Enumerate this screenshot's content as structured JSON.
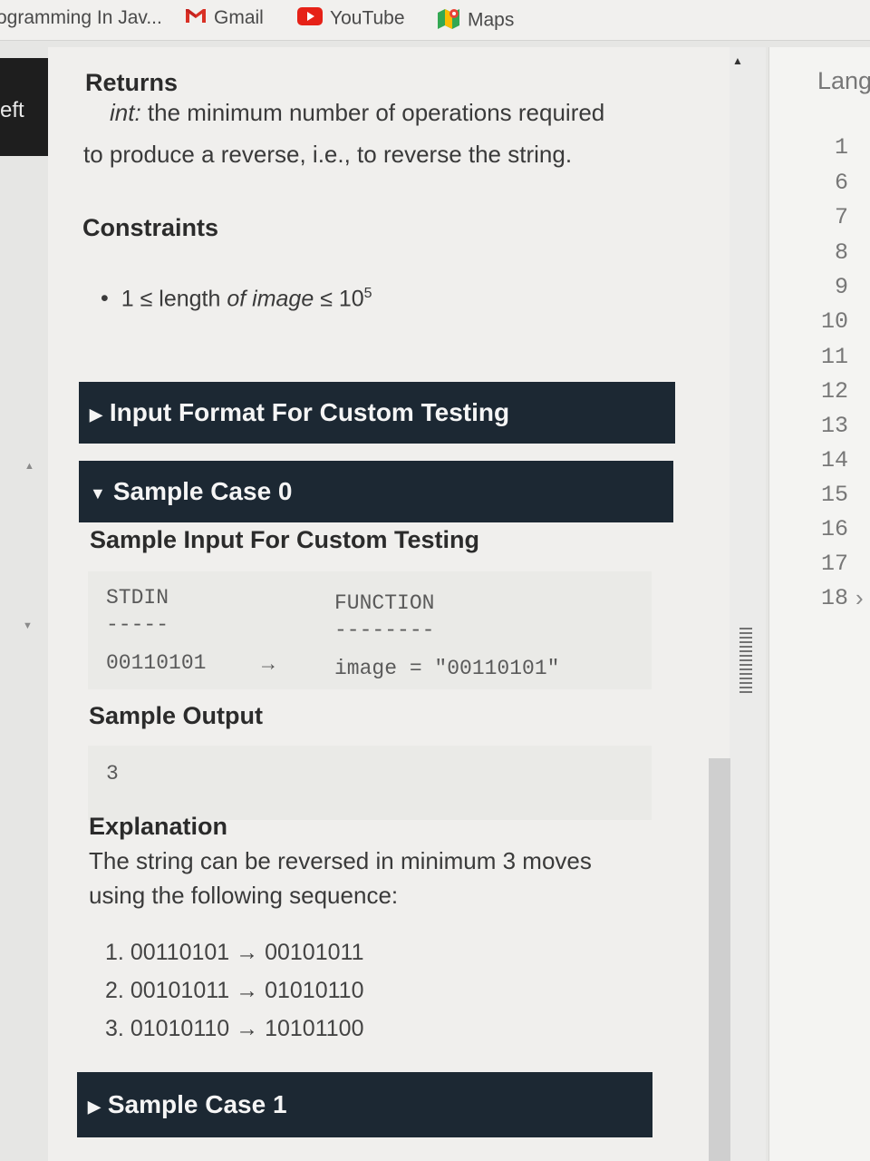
{
  "bookmarks": [
    {
      "label": "ogramming In Jav...",
      "icon": "page-icon"
    },
    {
      "label": "Gmail",
      "icon": "gmail-icon"
    },
    {
      "label": "YouTube",
      "icon": "youtube-icon"
    },
    {
      "label": "Maps",
      "icon": "maps-icon"
    }
  ],
  "left_panel": {
    "label": "eft"
  },
  "returns": {
    "heading": "Returns",
    "type": "int:",
    "line1": " the minimum number of operations required",
    "line2": "to produce a reverse, i.e., to reverse the string."
  },
  "constraints": {
    "heading": "Constraints",
    "item": {
      "prefix": "1 ≤ length ",
      "of": "of",
      "var": " image",
      "op": " ≤ 10",
      "exp": "5"
    }
  },
  "sections": {
    "input_format": "Input Format For Custom Testing",
    "sample_case_0": "Sample Case 0",
    "sample_case_1": "Sample Case 1"
  },
  "sample_input": {
    "heading": "Sample Input For Custom Testing",
    "col1_header": "STDIN",
    "col1_rule": "-----",
    "col2_header": "FUNCTION",
    "col2_rule": "--------",
    "value": "00110101",
    "arrow": "→",
    "assignment": "image = \"00110101\""
  },
  "sample_output": {
    "heading": "Sample Output",
    "value": "3"
  },
  "explanation": {
    "heading": "Explanation",
    "line1": "The string can be reversed in minimum 3 moves",
    "line2": "using the following sequence:",
    "steps": [
      {
        "num": "1.",
        "from": "00110101",
        "arrow": "→",
        "to": "00101011"
      },
      {
        "num": "2.",
        "from": "00101011",
        "arrow": "→",
        "to": "01010110"
      },
      {
        "num": "3.",
        "from": "01010110",
        "arrow": "→",
        "to": "10101100"
      }
    ]
  },
  "editor": {
    "lang_label": "Lang",
    "line_numbers": [
      "1",
      "6",
      "7",
      "8",
      "9",
      "10",
      "11",
      "12",
      "13",
      "14",
      "15",
      "16",
      "17",
      "18"
    ]
  },
  "colors": {
    "section_bar": "#1c2833",
    "page_bg": "#f0efed"
  }
}
